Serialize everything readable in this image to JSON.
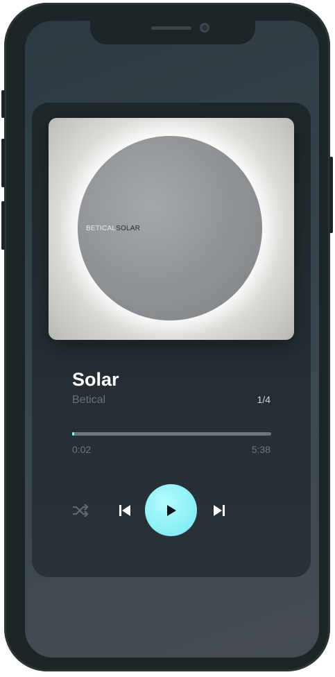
{
  "cover": {
    "artist_text": "BETICAL",
    "title_text": "SOLAR"
  },
  "track": {
    "title": "Solar",
    "artist": "Betical",
    "counter": "1/4"
  },
  "progress": {
    "current_time": "0:02",
    "total_time": "5:38",
    "fraction": 0.006
  },
  "controls": {
    "shuffle_icon": "shuffle-icon",
    "prev_icon": "skip-previous-icon",
    "play_icon": "play-icon",
    "next_icon": "skip-next-icon"
  },
  "colors": {
    "accent": "#8ef3f7",
    "muted_text": "#69757b",
    "card": "#242e33"
  }
}
